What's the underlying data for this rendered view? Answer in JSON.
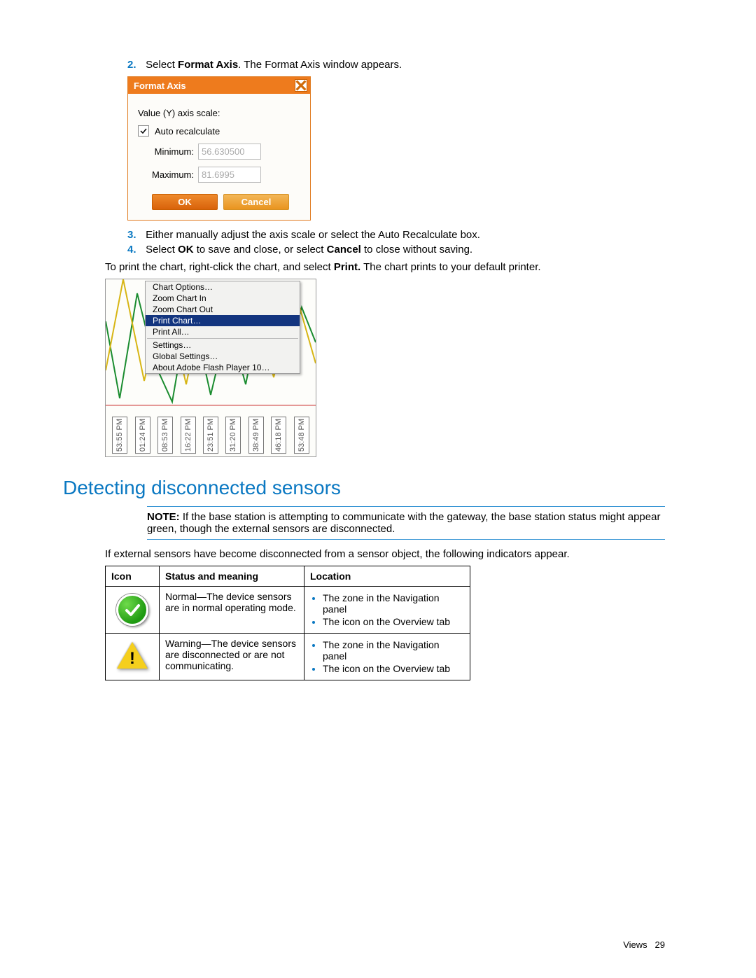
{
  "steps": {
    "s2": {
      "num": "2.",
      "pre": "Select ",
      "bold1": "Format Axis",
      "post": ". The Format Axis window appears."
    },
    "s3": {
      "num": "3.",
      "text": "Either manually adjust the axis scale or select the Auto Recalculate box."
    },
    "s4": {
      "num": "4.",
      "pre": "Select ",
      "bold1": "OK",
      "mid": " to save and close, or select ",
      "bold2": "Cancel",
      "post": " to close without saving."
    }
  },
  "format_axis": {
    "title": "Format Axis",
    "scale_label": "Value (Y) axis scale:",
    "auto_label": "Auto recalculate",
    "min_label": "Minimum:",
    "min_value": "56.630500",
    "max_label": "Maximum:",
    "max_value": "81.6995",
    "ok": "OK",
    "cancel": "Cancel"
  },
  "print_line": {
    "pre": "To print the chart, right-click the chart, and select ",
    "bold": "Print.",
    "post": " The chart prints to your default printer."
  },
  "context_menu": {
    "items_a": [
      "Chart Options…",
      "Zoom Chart In",
      "Zoom Chart Out"
    ],
    "selected": "Print Chart…",
    "items_b": [
      "Print All…"
    ],
    "items_c": [
      "Settings…",
      "Global Settings…",
      "About Adobe Flash Player 10…"
    ]
  },
  "chart_times": [
    "53:55 PM",
    "01:24 PM",
    "08:53 PM",
    "16:22 PM",
    "23:51 PM",
    "31:20 PM",
    "38:49 PM",
    "46:18 PM",
    "53:48 PM"
  ],
  "heading": "Detecting disconnected sensors",
  "note": {
    "bold": "NOTE:  ",
    "text": "If the base station is attempting to communicate with the gateway, the base station status might appear green, though the external sensors are disconnected."
  },
  "after_note": "If external sensors have become disconnected from a sensor object, the following indicators appear.",
  "table": {
    "h1": "Icon",
    "h2": "Status and meaning",
    "h3": "Location",
    "row1": {
      "status": "Normal—The device sensors are in normal operating mode.",
      "loc": [
        "The zone in the Navigation panel",
        "The icon on the Overview tab"
      ]
    },
    "row2": {
      "status": "Warning—The device sensors are disconnected or are not communicating.",
      "loc": [
        "The zone in the Navigation panel",
        "The icon on the Overview tab"
      ]
    }
  },
  "footer": {
    "section": "Views",
    "page": "29"
  }
}
